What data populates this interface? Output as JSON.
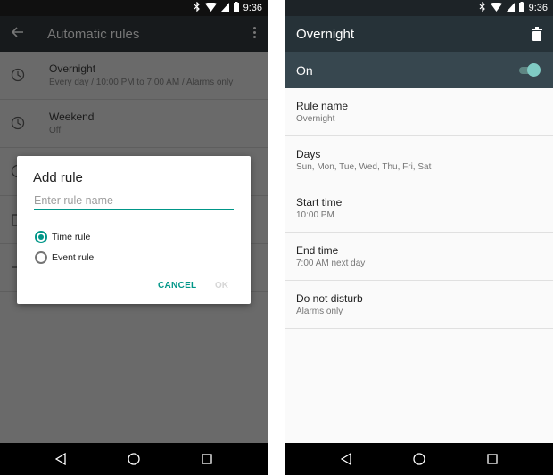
{
  "status_bar": {
    "time": "9:36",
    "icons": [
      "bluetooth-icon",
      "wifi-icon",
      "signal-icon",
      "battery-icon"
    ]
  },
  "left": {
    "header": {
      "title": "Automatic rules",
      "back_icon": "arrow-left-icon",
      "menu_icon": "more-vert-icon"
    },
    "rules": [
      {
        "title": "Overnight",
        "subtitle": "Every day / 10:00 PM to 7:00 AM / Alarms only",
        "icon": "clock-icon"
      },
      {
        "title": "Weekend",
        "subtitle": "Off",
        "icon": "clock-icon"
      },
      {
        "title": "",
        "subtitle": "",
        "icon": "clock-icon"
      },
      {
        "title": "",
        "subtitle": "",
        "icon": "calendar-icon"
      },
      {
        "title": "",
        "subtitle": "",
        "icon": "add-icon"
      }
    ],
    "dialog": {
      "title": "Add rule",
      "input_placeholder": "Enter rule name",
      "input_value": "",
      "options": [
        {
          "label": "Time rule",
          "checked": true
        },
        {
          "label": "Event rule",
          "checked": false
        }
      ],
      "cancel_label": "CANCEL",
      "ok_label": "OK"
    }
  },
  "right": {
    "header": {
      "title": "Overnight",
      "delete_icon": "trash-icon"
    },
    "toggle": {
      "label": "On",
      "enabled": true
    },
    "settings": [
      {
        "title": "Rule name",
        "value": "Overnight"
      },
      {
        "title": "Days",
        "value": "Sun, Mon, Tue, Wed, Thu, Fri, Sat"
      },
      {
        "title": "Start time",
        "value": "10:00 PM"
      },
      {
        "title": "End time",
        "value": "7:00 AM next day"
      },
      {
        "title": "Do not disturb",
        "value": "Alarms only"
      }
    ]
  },
  "nav_bar": {
    "buttons": [
      "back-nav-icon",
      "home-nav-icon",
      "recents-nav-icon"
    ]
  },
  "colors": {
    "accent": "#009688",
    "toggle_thumb": "#80cbc4",
    "appbar_right": "#263238",
    "toggle_row": "#37474f"
  }
}
